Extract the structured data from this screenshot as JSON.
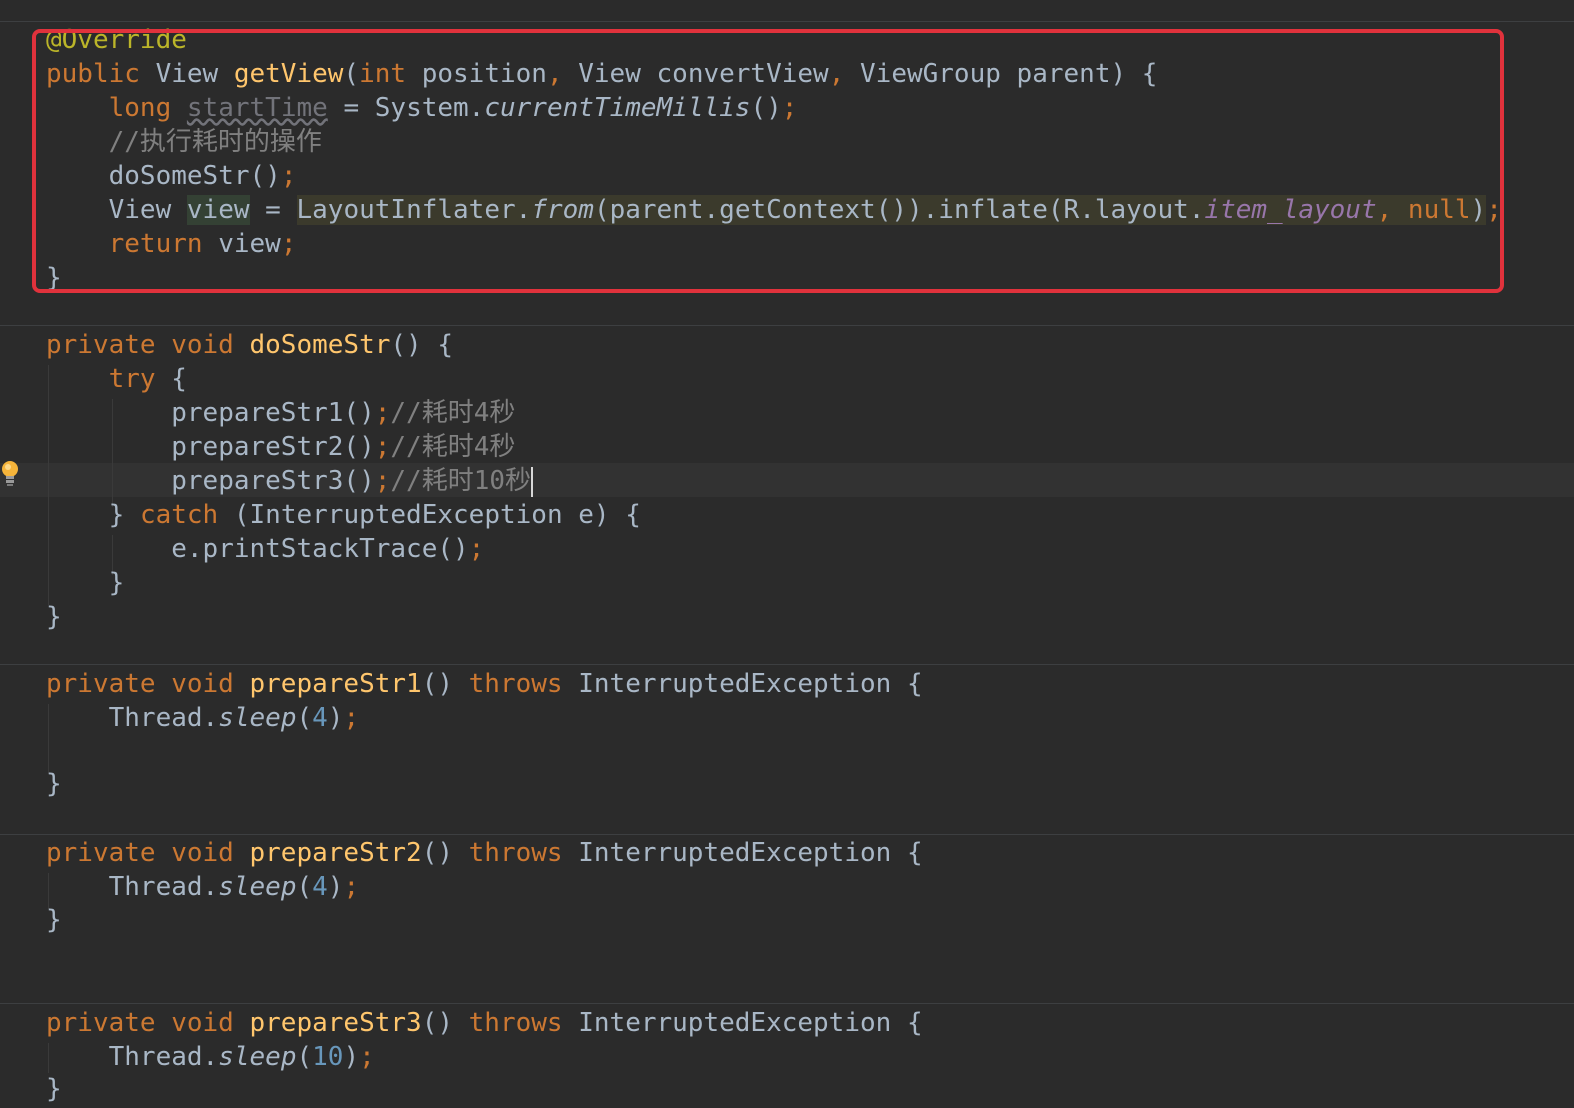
{
  "editor": {
    "language": "Java",
    "theme_colors": {
      "background": "#2b2b2b",
      "keyword": "#cc7832",
      "function": "#ffc66d",
      "annotation": "#bbb529",
      "comment": "#808080",
      "number": "#6897bb",
      "field": "#9876aa",
      "highlight_box": "#e0323c"
    },
    "highlighted_block": "getView",
    "gutter_icon": "lightbulb-icon"
  },
  "code": {
    "l1": {
      "annotation": "@Override"
    },
    "l2": {
      "kw_public": "public",
      "type": " View ",
      "name": "getView",
      "p1": "(",
      "kw_int": "int",
      "rest1": " position",
      "comma1": ",",
      "rest2": " View convertView",
      "comma2": ",",
      "rest3": " ViewGroup parent) {"
    },
    "l3": {
      "indent": "    ",
      "kw_long": "long",
      "sp": " ",
      "var": "startTime",
      "eq": " = System.",
      "call": "currentTimeMillis",
      "tail": "()",
      "semi": ";"
    },
    "l4": {
      "indent": "    ",
      "comment": "//执行耗时的操作"
    },
    "l5": {
      "indent": "    ",
      "call": "doSomeStr()",
      "semi": ";"
    },
    "l6": {
      "indent": "    ",
      "type": "View ",
      "var": "view",
      "eq": " = ",
      "expr1": "LayoutInflater.",
      "from": "from",
      "expr2": "(parent.getContext()).inflate(R.layout.",
      "field": "item_layout",
      "comma": ",",
      "sp": " ",
      "null": "null",
      "close": ")",
      "semi": ";"
    },
    "l7": {
      "indent": "    ",
      "kw_return": "return",
      "rest": " view",
      "semi": ";"
    },
    "l8": {
      "text": "}"
    },
    "l9": {
      "kw": "private void",
      "sp": " ",
      "name": "doSomeStr",
      "rest": "() {"
    },
    "l10": {
      "indent": "    ",
      "kw_try": "try",
      "rest": " {"
    },
    "l11": {
      "indent": "        ",
      "call": "prepareStr1()",
      "semi": ";",
      "comment": "//耗时4秒"
    },
    "l12": {
      "indent": "        ",
      "call": "prepareStr2()",
      "semi": ";",
      "comment": "//耗时4秒"
    },
    "l13": {
      "indent": "        ",
      "call": "prepareStr3()",
      "semi": ";",
      "comment": "//耗时10秒"
    },
    "l14": {
      "indent": "    ",
      "brace": "} ",
      "kw_catch": "catch",
      "rest": " (InterruptedException e) {"
    },
    "l15": {
      "indent": "        ",
      "call": "e.printStackTrace()",
      "semi": ";"
    },
    "l16": {
      "text": "    }"
    },
    "l17": {
      "text": "}"
    },
    "l18": {
      "kw": "private void",
      "sp": " ",
      "name": "prepareStr1",
      "paren": "() ",
      "kw_throws": "throws",
      "rest": " InterruptedException {"
    },
    "l19": {
      "indent": "    ",
      "pre": "Thread.",
      "call": "sleep",
      "open": "(",
      "num": "4",
      "close": ")",
      "semi": ";"
    },
    "l20": {
      "text": "}"
    },
    "l21": {
      "kw": "private void",
      "sp": " ",
      "name": "prepareStr2",
      "paren": "() ",
      "kw_throws": "throws",
      "rest": " InterruptedException {"
    },
    "l22": {
      "indent": "    ",
      "pre": "Thread.",
      "call": "sleep",
      "open": "(",
      "num": "4",
      "close": ")",
      "semi": ";"
    },
    "l23": {
      "text": "}"
    },
    "l24": {
      "kw": "private void",
      "sp": " ",
      "name": "prepareStr3",
      "paren": "() ",
      "kw_throws": "throws",
      "rest": " InterruptedException {"
    },
    "l25": {
      "indent": "    ",
      "pre": "Thread.",
      "call": "sleep",
      "open": "(",
      "num": "10",
      "close": ")",
      "semi": ";"
    },
    "l26": {
      "text": "}"
    }
  }
}
